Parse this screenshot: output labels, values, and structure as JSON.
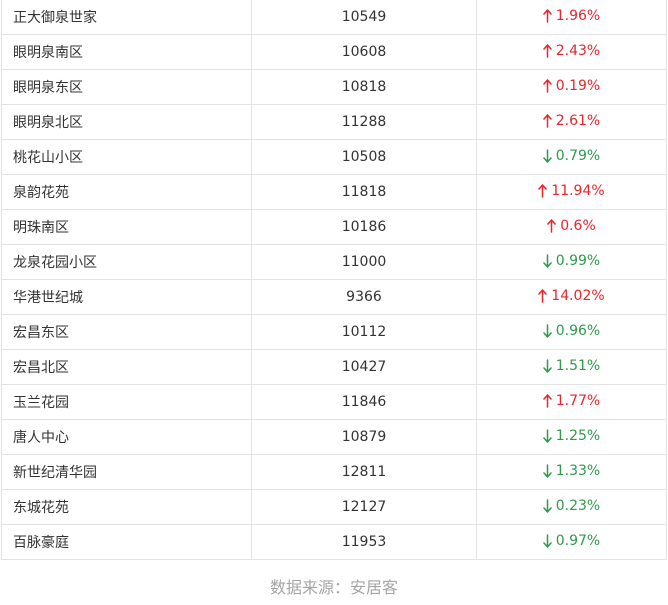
{
  "rows": [
    {
      "name": "正大御泉世家",
      "price": "10549",
      "direction": "up",
      "change": "1.96%"
    },
    {
      "name": "眼明泉南区",
      "price": "10608",
      "direction": "up",
      "change": "2.43%"
    },
    {
      "name": "眼明泉东区",
      "price": "10818",
      "direction": "up",
      "change": "0.19%"
    },
    {
      "name": "眼明泉北区",
      "price": "11288",
      "direction": "up",
      "change": "2.61%"
    },
    {
      "name": "桃花山小区",
      "price": "10508",
      "direction": "down",
      "change": "0.79%"
    },
    {
      "name": "泉韵花苑",
      "price": "11818",
      "direction": "up",
      "change": "11.94%"
    },
    {
      "name": "明珠南区",
      "price": "10186",
      "direction": "up",
      "change": "0.6%"
    },
    {
      "name": "龙泉花园小区",
      "price": "11000",
      "direction": "down",
      "change": "0.99%"
    },
    {
      "name": "华港世纪城",
      "price": "9366",
      "direction": "up",
      "change": "14.02%"
    },
    {
      "name": "宏昌东区",
      "price": "10112",
      "direction": "down",
      "change": "0.96%"
    },
    {
      "name": "宏昌北区",
      "price": "10427",
      "direction": "down",
      "change": "1.51%"
    },
    {
      "name": "玉兰花园",
      "price": "11846",
      "direction": "up",
      "change": "1.77%"
    },
    {
      "name": "唐人中心",
      "price": "10879",
      "direction": "down",
      "change": "1.25%"
    },
    {
      "name": "新世纪清华园",
      "price": "12811",
      "direction": "down",
      "change": "1.33%"
    },
    {
      "name": "东城花苑",
      "price": "12127",
      "direction": "down",
      "change": "0.23%"
    },
    {
      "name": "百脉豪庭",
      "price": "11953",
      "direction": "down",
      "change": "0.97%"
    }
  ],
  "colors": {
    "up": "#e5262d",
    "down": "#2f9a4b"
  },
  "icons": {
    "up": "arrow-up-icon",
    "down": "arrow-down-icon"
  },
  "footer": {
    "source": "数据来源：安居客"
  }
}
